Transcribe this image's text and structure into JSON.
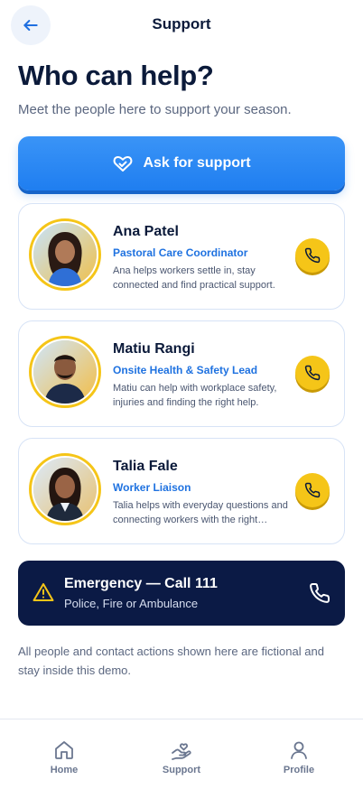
{
  "header": {
    "title": "Support",
    "back_icon": "arrow-left-icon"
  },
  "intro": {
    "title": "Who can help?",
    "subtitle": "Meet the people here to support your season."
  },
  "ask_button": {
    "label": "Ask for support",
    "icon": "heart-hand-icon"
  },
  "contacts": [
    {
      "name": "Ana Patel",
      "role": "Pastoral Care Coordinator",
      "description": "Ana helps workers settle in, stay connected and find practical support.",
      "call_icon": "phone-icon"
    },
    {
      "name": "Matiu Rangi",
      "role": "Onsite Health & Safety Lead",
      "description": "Matiu can help with workplace safety, injuries and finding the right help.",
      "call_icon": "phone-icon"
    },
    {
      "name": "Talia Fale",
      "role": "Worker Liaison",
      "description": "Talia helps with everyday questions and connecting workers with the right people.",
      "call_icon": "phone-icon"
    }
  ],
  "emergency": {
    "title": "Emergency — Call 111",
    "subtitle": "Police, Fire or Ambulance",
    "icon": "warning-icon",
    "call_icon": "phone-icon"
  },
  "disclaimer": "All people and contact actions shown here are fictional and stay inside this demo.",
  "nav": [
    {
      "label": "Home",
      "icon": "home-icon"
    },
    {
      "label": "Support",
      "icon": "hand-heart-icon"
    },
    {
      "label": "Profile",
      "icon": "user-icon"
    }
  ],
  "colors": {
    "primary": "#1f7ef0",
    "accent": "#f5c518",
    "navy": "#0b1a45",
    "role_text": "#1f72e0"
  }
}
